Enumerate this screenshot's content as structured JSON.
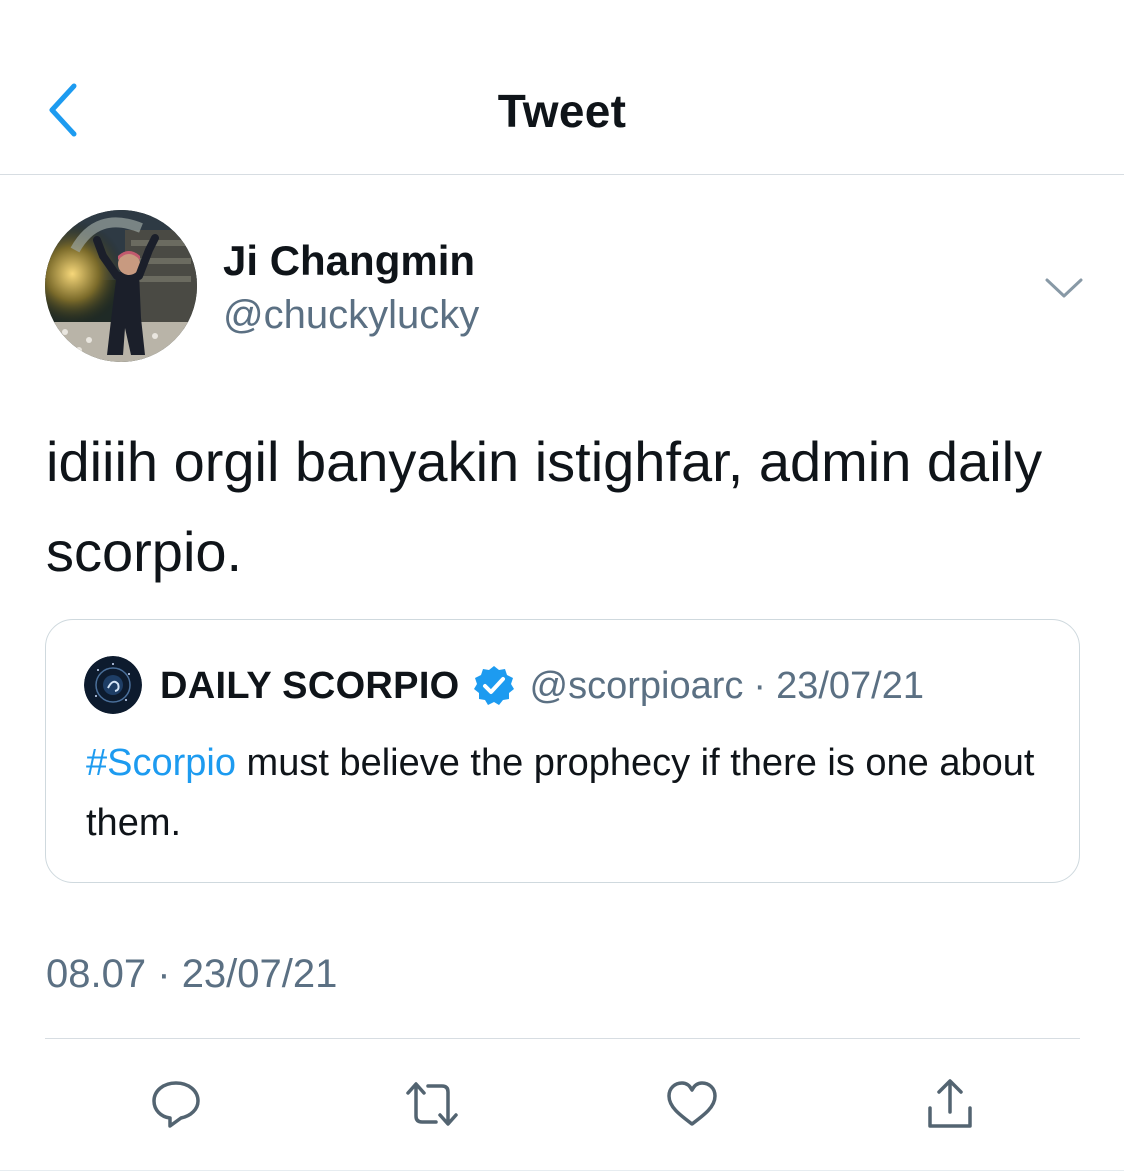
{
  "header": {
    "title": "Tweet",
    "back_icon": "chevron-left-icon"
  },
  "author": {
    "name": "Ji Changmin",
    "handle": "@chuckylucky"
  },
  "tweet": {
    "text": "idiiih orgil banyakin istighfar, admin daily scorpio.",
    "time": "08.07",
    "separator": "·",
    "date": "23/07/21"
  },
  "quote": {
    "name": "DAILY SCORPIO",
    "verified": true,
    "handle": "@scorpioarc",
    "separator": "·",
    "date": "23/07/21",
    "hashtag": "#Scorpio",
    "text": " must believe the prophecy if there is one about them."
  },
  "actions": {
    "reply_icon": "reply-icon",
    "retweet_icon": "retweet-icon",
    "like_icon": "heart-icon",
    "share_icon": "share-icon"
  },
  "colors": {
    "accent": "#1d9bf0",
    "secondary_text": "#5b7083",
    "icon": "#536471",
    "divider": "#d7dde2"
  }
}
